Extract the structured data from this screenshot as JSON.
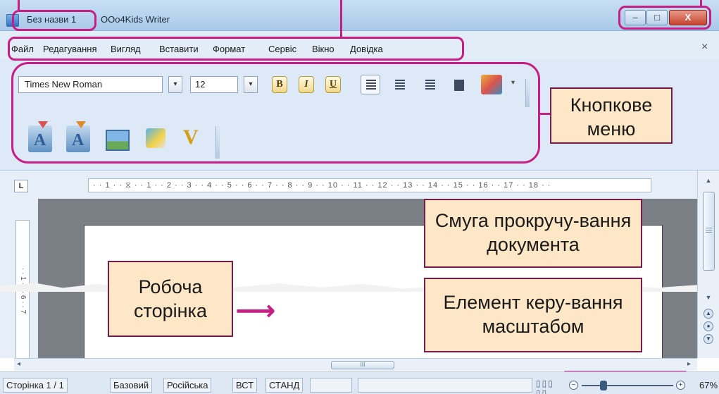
{
  "window": {
    "doc_title": "Без назви 1",
    "app_title": "OOo4Kids Writer",
    "minimize_glyph": "–",
    "maximize_glyph": "□",
    "close_glyph": "X"
  },
  "menu": {
    "items": [
      "Файл",
      "Редагування",
      "Вигляд",
      "Вставити",
      "Формат",
      "Сервіс",
      "Вікно",
      "Довідка"
    ],
    "close_glyph": "×"
  },
  "toolbar": {
    "font_name": "Times New Roman",
    "font_size": "12",
    "bold_label": "B",
    "italic_label": "I",
    "underline_label": "U",
    "dropdown_glyph": "▾",
    "big_icons": [
      "fontwork-icon",
      "text-effect-icon",
      "image-icon",
      "gallery-icon",
      "drawing-pen-icon"
    ]
  },
  "callouts": {
    "button_menu": "Кнопкове меню",
    "scrollbar": "Смуга прокручу-вання документа",
    "work_page": "Робоча сторінка",
    "zoom": "Елемент керу-вання масштабом",
    "arrow": "⟶"
  },
  "ruler": {
    "corner": "L",
    "marks": "· · 1 · · ⧖ · · 1 · · 2 · · 3 · · 4 · · 5 · · 6 · · 7 · · 8 · · 9 · · 10 · · 11 · · 12 · · 13 · · 14 · · 15 · · 16 · · 17 · · 18 · ·",
    "vertical_marks": "· · 1 · ·   · 6 · · 7"
  },
  "scrollbar": {
    "up": "▲",
    "down": "▼",
    "hscroll_grip": "III",
    "left": "◂",
    "right": "▸",
    "nav_prev": "▲",
    "nav_mid": "●",
    "nav_next": "▼"
  },
  "status": {
    "page": "Сторінка 1 / 1",
    "style": "Базовий",
    "language": "Російська",
    "insert_mode": "ВСТ",
    "selection_mode": "СТАНД",
    "view_icons": "▯▯▯ ▯▯",
    "zoom_minus": "−",
    "zoom_plus": "+",
    "zoom_percent": "67%",
    "zoom_level": 0.24
  },
  "colors": {
    "accent": "#c61e84",
    "callout_fill": "#fde7c6",
    "titlebar": "#b9d3ee"
  }
}
